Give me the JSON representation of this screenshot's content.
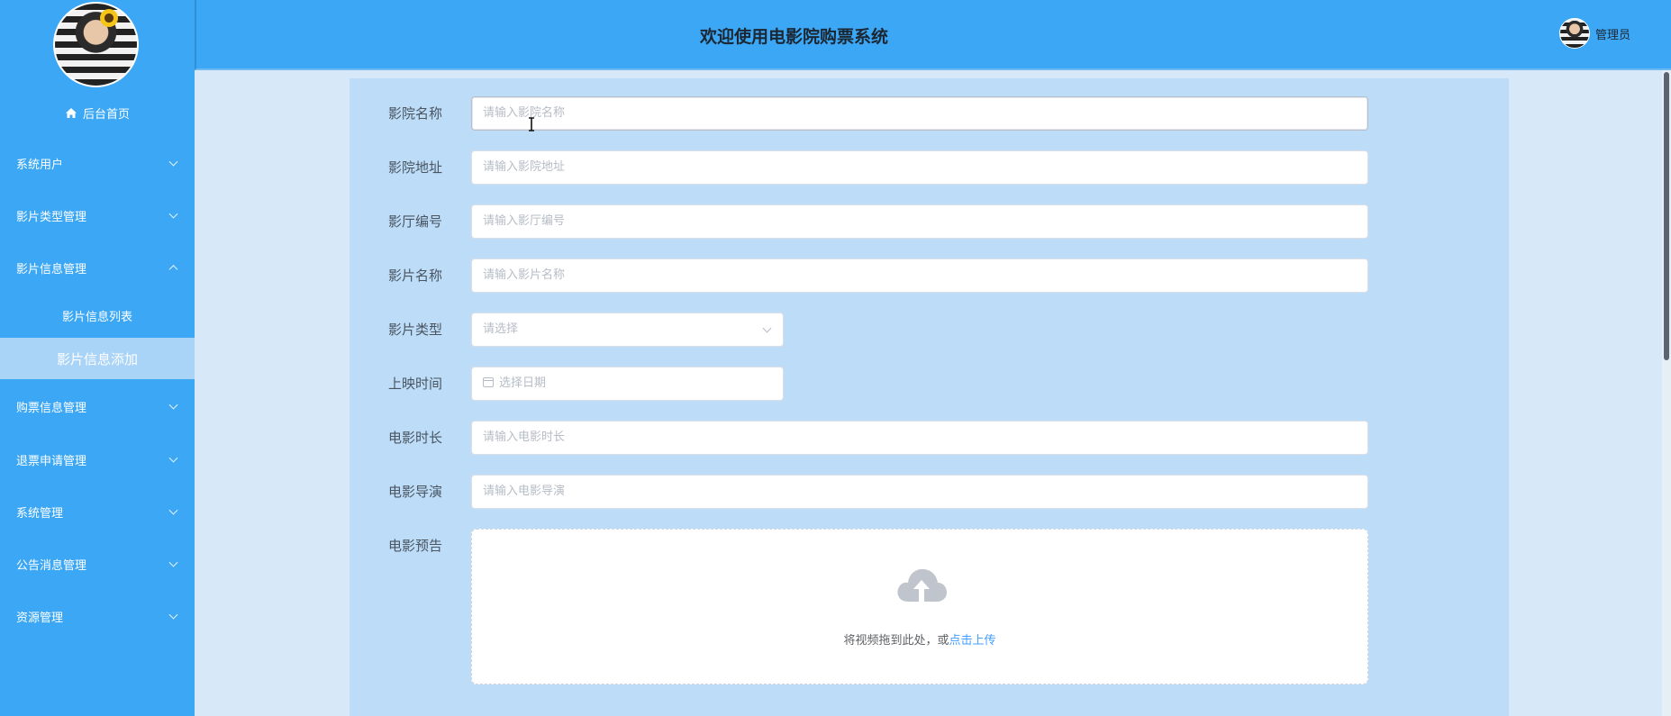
{
  "sidebar": {
    "home_label": "后台首页",
    "menu": [
      {
        "label": "系统用户",
        "expanded": false
      },
      {
        "label": "影片类型管理",
        "expanded": false
      },
      {
        "label": "影片信息管理",
        "expanded": true
      },
      {
        "label": "购票信息管理",
        "expanded": false
      },
      {
        "label": "退票申请管理",
        "expanded": false
      },
      {
        "label": "系统管理",
        "expanded": false
      },
      {
        "label": "公告消息管理",
        "expanded": false
      },
      {
        "label": "资源管理",
        "expanded": false
      }
    ],
    "submenu": [
      {
        "label": "影片信息列表",
        "active": false
      },
      {
        "label": "影片信息添加",
        "active": true
      }
    ]
  },
  "header": {
    "title": "欢迎使用电影院购票系统",
    "user_label": "管理员"
  },
  "form": {
    "fields": [
      {
        "label": "影院名称",
        "placeholder": "请输入影院名称"
      },
      {
        "label": "影院地址",
        "placeholder": "请输入影院地址"
      },
      {
        "label": "影厅编号",
        "placeholder": "请输入影厅编号"
      },
      {
        "label": "影片名称",
        "placeholder": "请输入影片名称"
      },
      {
        "label": "影片类型",
        "placeholder": "请选择"
      },
      {
        "label": "上映时间",
        "placeholder": "选择日期"
      },
      {
        "label": "电影时长",
        "placeholder": "请输入电影时长"
      },
      {
        "label": "电影导演",
        "placeholder": "请输入电影导演"
      },
      {
        "label": "电影预告"
      }
    ],
    "upload": {
      "text": "将视频拖到此处，或",
      "link": "点击上传"
    }
  },
  "colors": {
    "primary": "#3ca7f5",
    "active_submenu": "#a9d3f7",
    "link": "#409eff"
  }
}
